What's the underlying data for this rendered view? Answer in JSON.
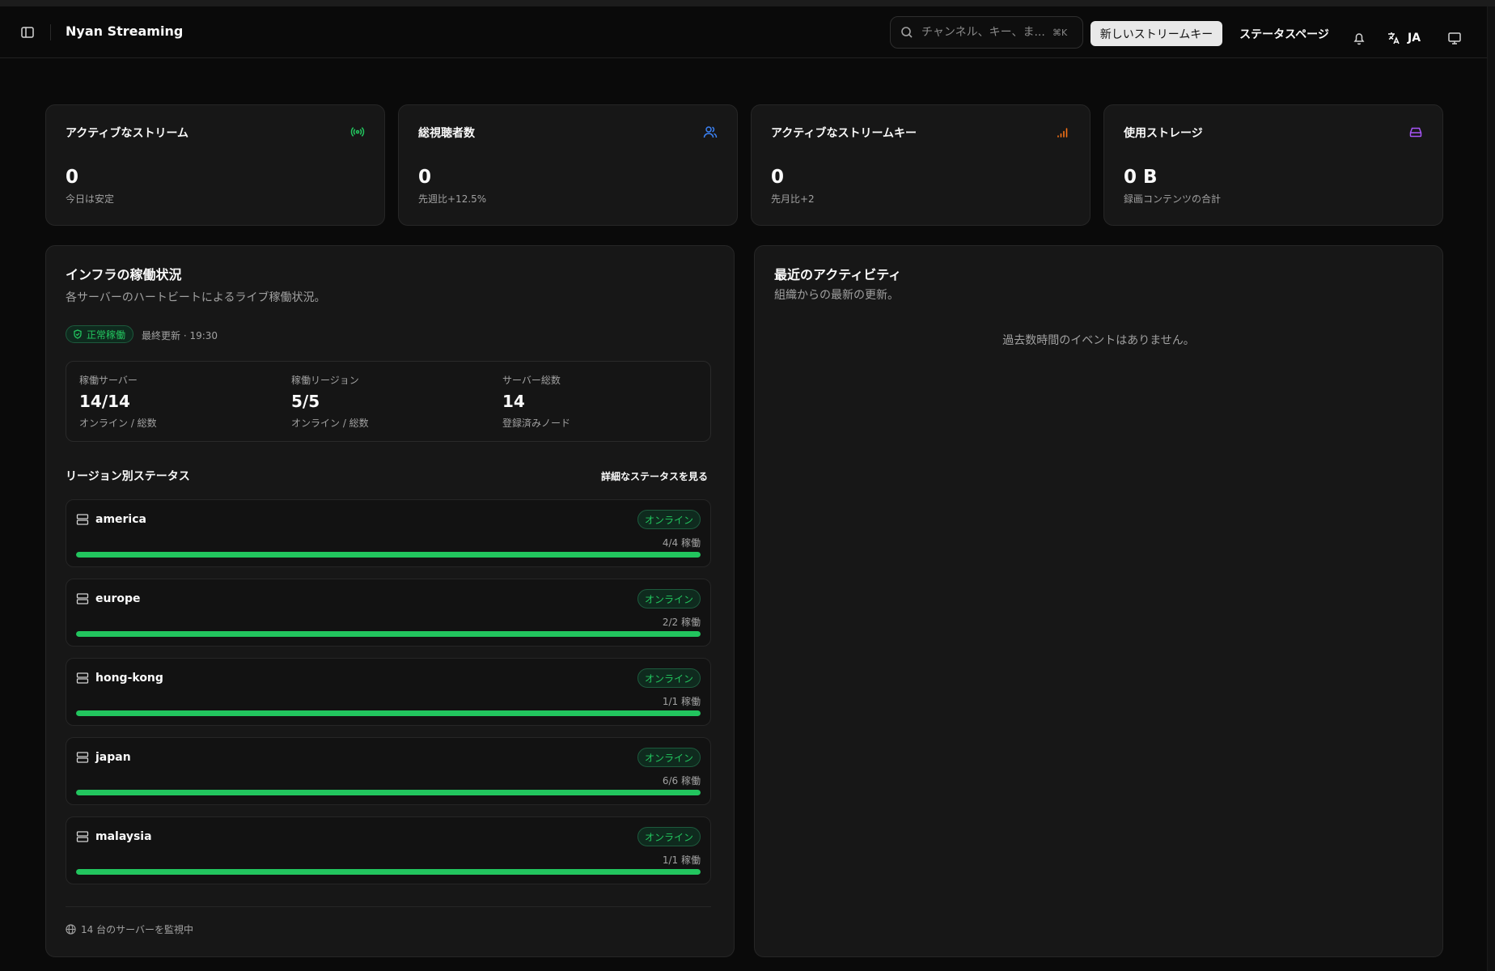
{
  "app": {
    "title": "Nyan Streaming"
  },
  "header": {
    "search_placeholder": "チャンネル、キー、ま...",
    "search_shortcut": "⌘K",
    "new_key_label": "新しいストリームキー",
    "status_page_label": "ステータスページ",
    "language_code": "JA",
    "icons": [
      "sidebar-toggle-icon",
      "search-icon",
      "bell-icon",
      "translate-icon",
      "monitor-icon"
    ]
  },
  "stats": [
    {
      "title": "アクティブなストリーム",
      "value": "0",
      "sub": "今日は安定",
      "icon": "broadcast-icon",
      "icon_color": "#22c55e"
    },
    {
      "title": "総視聴者数",
      "value": "0",
      "sub": "先週比+12.5%",
      "icon": "users-icon",
      "icon_color": "#3b82f6"
    },
    {
      "title": "アクティブなストリームキー",
      "value": "0",
      "sub": "先月比+2",
      "icon": "signal-icon",
      "icon_color": "#f97316"
    },
    {
      "title": "使用ストレージ",
      "value": "0 B",
      "sub": "録画コンテンツの合計",
      "icon": "hard-drive-icon",
      "icon_color": "#a855f7"
    }
  ],
  "infra": {
    "title": "インフラの稼働状況",
    "description": "各サーバーのハートビートによるライブ稼働状況。",
    "health_label": "正常稼働",
    "last_updated": "最終更新 · 19:30",
    "summary": [
      {
        "label": "稼働サーバー",
        "value": "14/14",
        "sub": "オンライン / 総数"
      },
      {
        "label": "稼働リージョン",
        "value": "5/5",
        "sub": "オンライン / 総数"
      },
      {
        "label": "サーバー総数",
        "value": "14",
        "sub": "登録済みノード"
      }
    ],
    "region_header": "リージョン別ステータス",
    "detail_link": "詳細なステータスを見る",
    "regions": [
      {
        "name": "america",
        "status": "オンライン",
        "count": "4/4 稼働",
        "ratio": 1.0
      },
      {
        "name": "europe",
        "status": "オンライン",
        "count": "2/2 稼働",
        "ratio": 1.0
      },
      {
        "name": "hong-kong",
        "status": "オンライン",
        "count": "1/1 稼働",
        "ratio": 1.0
      },
      {
        "name": "japan",
        "status": "オンライン",
        "count": "6/6 稼働",
        "ratio": 1.0
      },
      {
        "name": "malaysia",
        "status": "オンライン",
        "count": "1/1 稼働",
        "ratio": 1.0
      }
    ],
    "footer": "14 台のサーバーを監視中"
  },
  "activity": {
    "title": "最近のアクティビティ",
    "description": "組織からの最新の更新。",
    "empty": "過去数時間のイベントはありません。"
  },
  "colors": {
    "accent_green": "#22c55e",
    "background": "#0a0a0a",
    "card": "#171717"
  }
}
